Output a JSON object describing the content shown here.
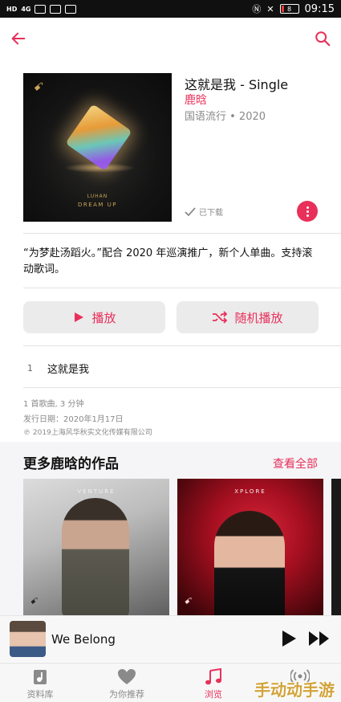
{
  "status_bar": {
    "network_label": "HD",
    "network_speed": "4G",
    "battery": "8",
    "time": "09:15"
  },
  "album": {
    "title": "这就是我 - Single",
    "artist": "鹿晗",
    "meta": "国语流行 • 2020",
    "downloaded_label": "已下载",
    "cover_artist": "LUHAN",
    "cover_subtitle": "DREAM UP",
    "description": "“为梦赴汤蹈火。”配合 2020 年巡演推广，新个人单曲。支持滚动歌词。"
  },
  "actions": {
    "play_label": "播放",
    "shuffle_label": "随机播放"
  },
  "tracks": [
    {
      "number": "1",
      "name": "这就是我"
    }
  ],
  "info": {
    "summary": "1 首歌曲, 3 分钟",
    "release_date": "发行日期：2020年1月17日",
    "copyright": "℗ 2019上海风华秋实文化传媒有限公司"
  },
  "more_by_artist": {
    "title": "更多鹿晗的作品",
    "see_all": "查看全部",
    "albums": [
      {
        "cover_text": "VENTURE"
      },
      {
        "cover_text": "XPLORE"
      }
    ]
  },
  "mini_player": {
    "title": "We Belong"
  },
  "tab_bar": {
    "tabs": [
      {
        "label": "资料库",
        "icon": "library-icon",
        "active": false
      },
      {
        "label": "为你推荐",
        "icon": "heart-icon",
        "active": false
      },
      {
        "label": "浏览",
        "icon": "music-note-icon",
        "active": true
      },
      {
        "label": "广播",
        "icon": "radio-icon",
        "active": false
      }
    ]
  },
  "watermark": "手动动手游",
  "colors": {
    "accent": "#e8305a",
    "status_bar": "#101010"
  }
}
